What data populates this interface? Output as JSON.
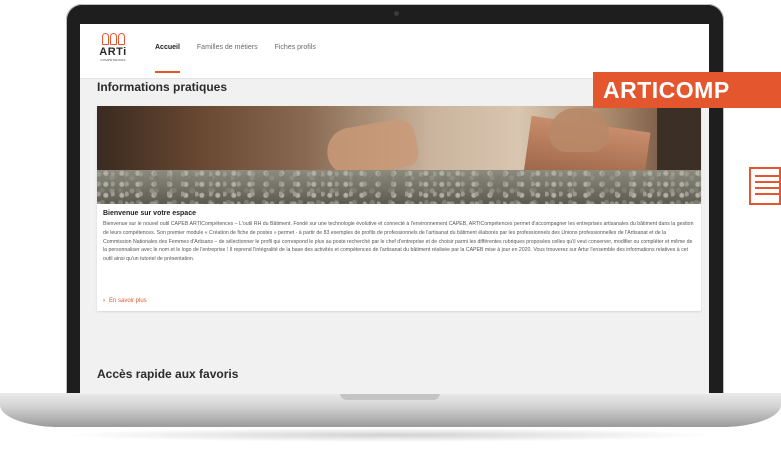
{
  "nav": {
    "items": [
      {
        "label": "Accueil",
        "active": true
      },
      {
        "label": "Familles de métiers",
        "active": false
      },
      {
        "label": "Fiches profils",
        "active": false
      }
    ]
  },
  "logo": {
    "text": "ARTi",
    "subtitle": "COMPÉTENCES"
  },
  "section1": {
    "title": "Informations pratiques"
  },
  "card": {
    "title": "Bienvenue sur votre espace",
    "body": "Bienvenue sur le nouvel outil CAPEB ARTICompétences – L'outil RH du Bâtiment. Fondé sur une technologie évolutive et connecté à l'environnement CAPEB, ARTICompétences permet d'accompagner les entreprises artisanales du bâtiment dans la gestion de leurs compétences. Son premier module « Création de fiche de postes » permet - à partir de 83 exemples de profils de professionnels de l'artisanat du bâtiment élaborés par les professionnels des Unions professionnelles de l'Artisanat et de la Commission Nationales des Femmes d'Artisans – de sélectionner le profil qui correspond le plus au poste recherché par le chef d'entreprise et de choisir parmi les différentes rubriques proposées celles qu'il veut conserver, modifier ou compléter et même de la personnaliser avec le nom et le logo de l'entreprise ! Il reprend l'intégralité de la base des activités et compétences de l'artisanat du bâtiment réalisée par la CAPEB mise à jour en 2020. Vous trouverez sur Artur l'ensemble des informations relatives à cet outil ainsi qu'un tutoriel de présentation.",
    "link": "En savoir plus"
  },
  "section2": {
    "title": "Accès rapide aux favoris"
  },
  "banner": {
    "text": "ARTICOMP"
  },
  "colors": {
    "accent": "#e4572e",
    "screen_bg": "#f1f1f1",
    "bezel": "#1e1e1f"
  },
  "icons": [
    "chevron-right-icon",
    "document-list-icon",
    "people-logo-icon"
  ]
}
